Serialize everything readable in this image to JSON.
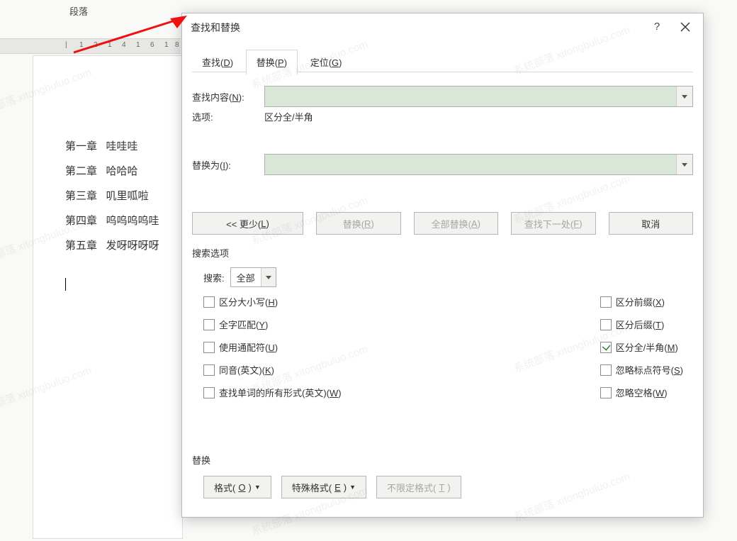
{
  "ribbon": {
    "group_label": "段落"
  },
  "ruler_marks": [
    "1",
    "2",
    "1",
    "4",
    "1",
    "6",
    "1",
    "8"
  ],
  "document": {
    "lines": [
      "第一章   哇哇哇",
      "第二章   哈哈哈",
      "第三章   叽里呱啦",
      "第四章   呜呜呜呜哇",
      "第五章   发呀呀呀呀"
    ]
  },
  "dialog": {
    "title": "查找和替换",
    "help": "?",
    "tabs": {
      "find": {
        "prefix": "查找(",
        "key": "D",
        "suffix": ")"
      },
      "replace": {
        "prefix": "替换(",
        "key": "P",
        "suffix": ")"
      },
      "goto": {
        "prefix": "定位(",
        "key": "G",
        "suffix": ")"
      }
    },
    "find_label": {
      "prefix": "查找内容(",
      "key": "N",
      "suffix": "):"
    },
    "find_value": "",
    "options_label": "选项:",
    "options_value": "区分全/半角",
    "replace_label": {
      "prefix": "替换为(",
      "key": "I",
      "suffix": "):"
    },
    "replace_value": "",
    "buttons": {
      "less": {
        "prefix": "<< 更少(",
        "key": "L",
        "suffix": ")"
      },
      "replace": {
        "prefix": "替换(",
        "key": "R",
        "suffix": ")"
      },
      "replace_all": {
        "prefix": "全部替换(",
        "key": "A",
        "suffix": ")"
      },
      "find_next": {
        "prefix": "查找下一处(",
        "key": "F",
        "suffix": ")"
      },
      "cancel": "取消"
    },
    "search_section": "搜索选项",
    "search_label": "搜索:",
    "search_value": "全部",
    "checks_left": [
      {
        "prefix": "区分大小写(",
        "key": "H",
        "suffix": ")",
        "checked": false
      },
      {
        "prefix": "全字匹配(",
        "key": "Y",
        "suffix": ")",
        "checked": false
      },
      {
        "prefix": "使用通配符(",
        "key": "U",
        "suffix": ")",
        "checked": false
      },
      {
        "prefix": "同音(英文)(",
        "key": "K",
        "suffix": ")",
        "checked": false
      },
      {
        "prefix": "查找单词的所有形式(英文)(",
        "key": "W",
        "suffix": ")",
        "checked": false
      }
    ],
    "checks_right": [
      {
        "prefix": "区分前缀(",
        "key": "X",
        "suffix": ")",
        "checked": false
      },
      {
        "prefix": "区分后缀(",
        "key": "T",
        "suffix": ")",
        "checked": false
      },
      {
        "prefix": "区分全/半角(",
        "key": "M",
        "suffix": ")",
        "checked": true
      },
      {
        "prefix": "忽略标点符号(",
        "key": "S",
        "suffix": ")",
        "checked": false
      },
      {
        "prefix": "忽略空格(",
        "key": "W",
        "suffix": ")",
        "checked": false
      }
    ],
    "replace_section": "替换",
    "format_buttons": {
      "format": {
        "prefix": "格式(",
        "key": "O",
        "suffix": ")"
      },
      "special": {
        "prefix": "特殊格式(",
        "key": "E",
        "suffix": ")"
      },
      "nofmt": {
        "prefix": "不限定格式(",
        "key": "T",
        "suffix": ")"
      }
    }
  },
  "watermark": "系统部落 xitongbuluo.com"
}
